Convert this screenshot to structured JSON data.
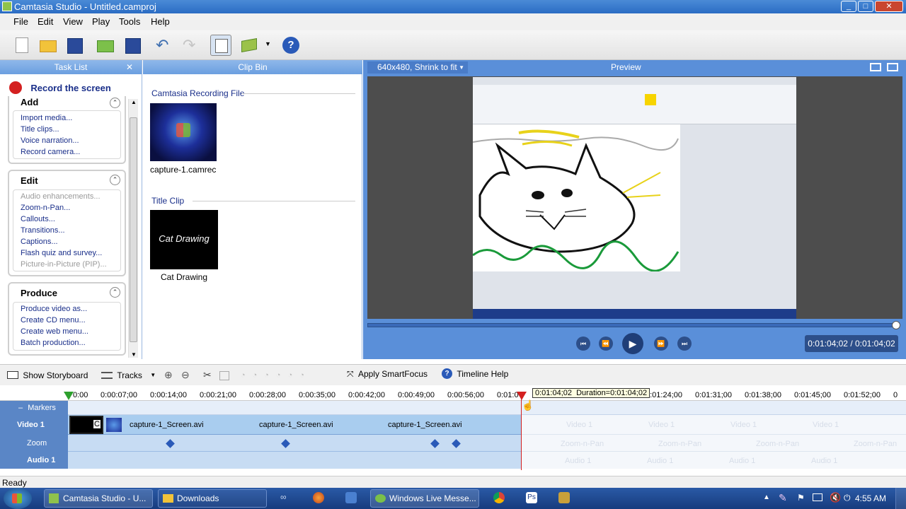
{
  "window": {
    "title": "Camtasia Studio - Untitled.camproj"
  },
  "menu": [
    "File",
    "Edit",
    "View",
    "Play",
    "Tools",
    "Help"
  ],
  "tasklist": {
    "title": "Task List",
    "record": "Record the screen",
    "add": {
      "title": "Add",
      "items": [
        "Import media...",
        "Title clips...",
        "Voice narration...",
        "Record camera..."
      ]
    },
    "edit": {
      "title": "Edit",
      "items": [
        "Audio enhancements...",
        "Zoom-n-Pan...",
        "Callouts...",
        "Transitions...",
        "Captions...",
        "Flash quiz and survey...",
        "Picture-in-Picture (PIP)..."
      ]
    },
    "produce": {
      "title": "Produce",
      "items": [
        "Produce video as...",
        "Create CD menu...",
        "Create web menu...",
        "Batch production..."
      ]
    }
  },
  "clipbin": {
    "title": "Clip Bin",
    "section1": "Camtasia Recording File",
    "clip1": "capture-1.camrec",
    "section2": "Title Clip",
    "title_clip_text": "Cat Drawing",
    "clip2": "Cat Drawing"
  },
  "preview": {
    "title": "Preview",
    "size_select": "640x480, Shrink to fit",
    "time": "0:01:04;02 / 0:01:04;02"
  },
  "timeline_toolbar": {
    "storyboard": "Show Storyboard",
    "tracks": "Tracks",
    "smartfocus": "Apply SmartFocus",
    "help": "Timeline Help"
  },
  "timeline": {
    "ticks": [
      "0:00",
      "0:00:07;00",
      "0:00:14;00",
      "0:00:21;00",
      "0:00:28;00",
      "0:00:35;00",
      "0:00:42;00",
      "0:00:49;00",
      "0:00:56;00",
      "0:01:0",
      "0:01:24;00",
      "0:01:31;00",
      "0:01:38;00",
      "0:01:45;00",
      "0:01:52;00",
      "0"
    ],
    "playhead_label": "0:01:04;02  Duration=0:01:04;02",
    "tracks": [
      "Markers",
      "Video 1",
      "Zoom",
      "Audio 1"
    ],
    "clip_labels": [
      "capture-1_Screen.avi",
      "capture-1_Screen.avi",
      "capture-1_Screen.avi"
    ],
    "title_clip_char": "C",
    "ghost": {
      "video": "Video 1",
      "zoom": "Zoom-n-Pan",
      "audio": "Audio 1"
    }
  },
  "status": "Ready",
  "taskbar": {
    "items": [
      "Camtasia Studio - U...",
      "Downloads",
      "Windows Live Messe..."
    ],
    "clock": "4:55 AM"
  },
  "colors": {
    "accent": "#5a8fd9",
    "record": "#d42020",
    "link": "#1a2f8a"
  }
}
